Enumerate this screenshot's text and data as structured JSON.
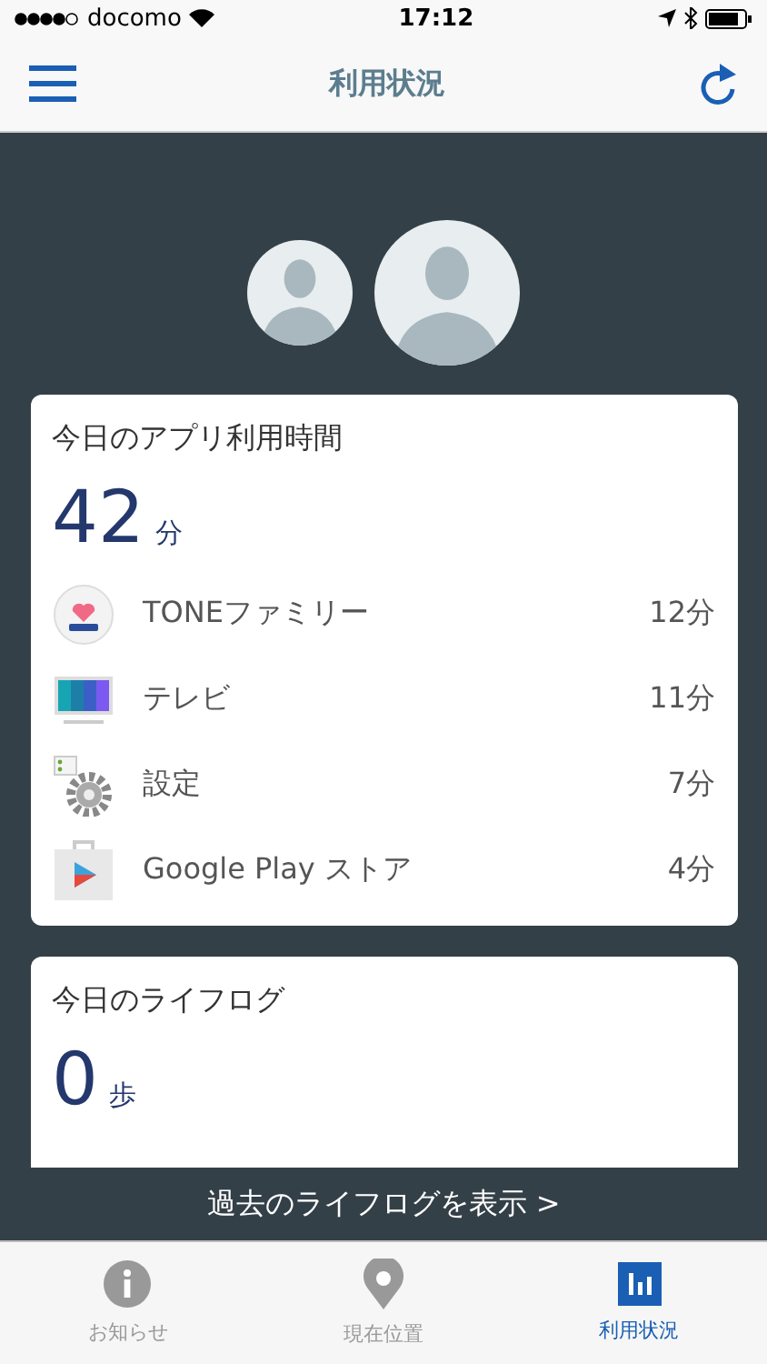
{
  "status_bar": {
    "carrier": "docomo",
    "time": "17:12"
  },
  "nav_bar": {
    "title": "利用状況"
  },
  "app_usage": {
    "title": "今日のアプリ利用時間",
    "total": "42",
    "unit": "分",
    "apps": [
      {
        "kind": "family",
        "name": "TONEファミリー",
        "time": "12分"
      },
      {
        "kind": "tv",
        "name": "テレビ",
        "time": "11分"
      },
      {
        "kind": "settings",
        "name": "設定",
        "time": "7分"
      },
      {
        "kind": "store",
        "name": "Google Play ストア",
        "time": "4分"
      }
    ]
  },
  "lifelog": {
    "title": "今日のライフログ",
    "steps": "0",
    "unit": "歩"
  },
  "history_link": "過去のライフログを表示 >",
  "tabs": [
    {
      "kind": "info",
      "label": "お知らせ",
      "selected": false
    },
    {
      "kind": "location",
      "label": "現在位置",
      "selected": false
    },
    {
      "kind": "usage",
      "label": "利用状況",
      "selected": true
    }
  ]
}
